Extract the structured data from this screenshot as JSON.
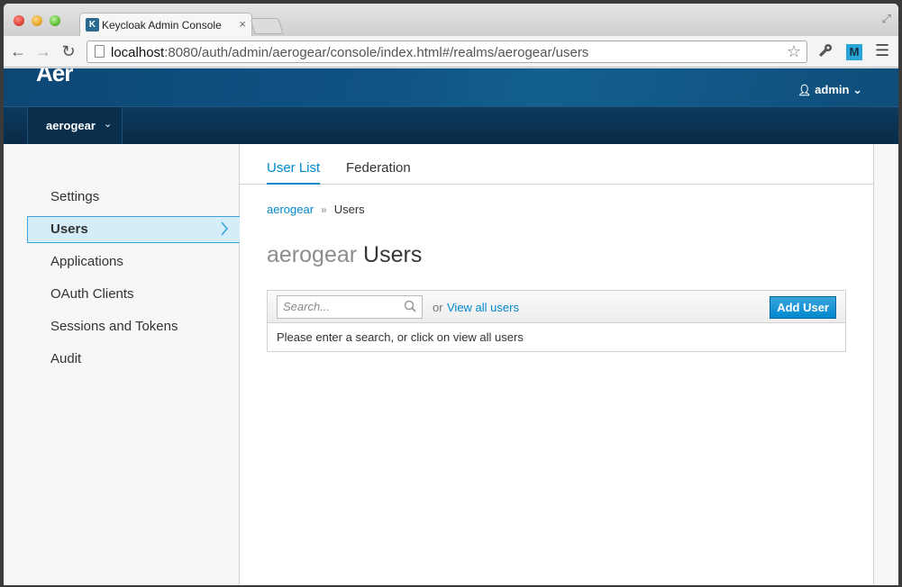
{
  "browser": {
    "tab_title": "Keycloak Admin Console",
    "tab_close": "×",
    "url_host": "localhost",
    "url_path": ":8080/auth/admin/aerogear/console/index.html#/realms/aerogear/users",
    "ext_label": "M"
  },
  "header": {
    "logo": "Aer",
    "user": "admin"
  },
  "realm": {
    "name": "aerogear"
  },
  "sidebar": {
    "items": [
      {
        "label": "Settings"
      },
      {
        "label": "Users"
      },
      {
        "label": "Applications"
      },
      {
        "label": "OAuth Clients"
      },
      {
        "label": "Sessions and Tokens"
      },
      {
        "label": "Audit"
      }
    ]
  },
  "tabs": {
    "user_list": "User List",
    "federation": "Federation"
  },
  "breadcrumb": {
    "realm": "aerogear",
    "separator": "»",
    "current": "Users"
  },
  "page_title": {
    "realm": "aerogear",
    "title": "Users"
  },
  "search": {
    "placeholder": "Search...",
    "or": "or",
    "view_all": "View all users",
    "add_user": "Add User",
    "message": "Please enter a search, or click on view all users"
  },
  "colors": {
    "accent": "#0088ce",
    "header": "#0f5485",
    "active_bg": "#d4edf8"
  }
}
